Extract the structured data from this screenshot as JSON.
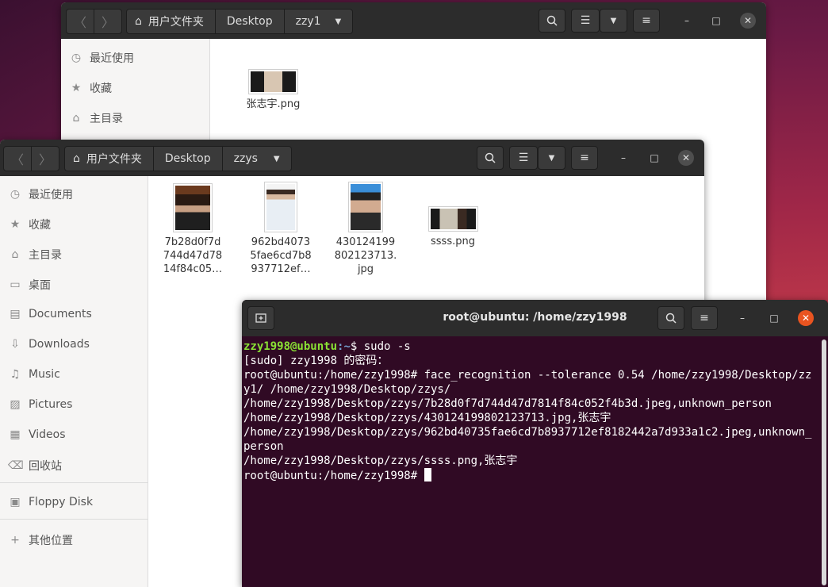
{
  "window1": {
    "path": [
      "用户文件夹",
      "Desktop",
      "zzy1"
    ],
    "sidebar": [
      {
        "icon": "clock-icon",
        "glyph": "◷",
        "label": "最近使用"
      },
      {
        "icon": "star-icon",
        "glyph": "★",
        "label": "收藏"
      },
      {
        "icon": "home-icon",
        "glyph": "⌂",
        "label": "主目录"
      }
    ],
    "files": [
      {
        "name": "张志宇.png"
      }
    ]
  },
  "window2": {
    "path": [
      "用户文件夹",
      "Desktop",
      "zzys"
    ],
    "sidebar": [
      {
        "icon": "clock-icon",
        "glyph": "◷",
        "label": "最近使用"
      },
      {
        "icon": "star-icon",
        "glyph": "★",
        "label": "收藏"
      },
      {
        "icon": "home-icon",
        "glyph": "⌂",
        "label": "主目录"
      },
      {
        "icon": "desktop-icon",
        "glyph": "▭",
        "label": "桌面"
      },
      {
        "icon": "document-icon",
        "glyph": "▤",
        "label": "Documents"
      },
      {
        "icon": "download-icon",
        "glyph": "⇩",
        "label": "Downloads"
      },
      {
        "icon": "music-icon",
        "glyph": "♫",
        "label": "Music"
      },
      {
        "icon": "pictures-icon",
        "glyph": "▨",
        "label": "Pictures"
      },
      {
        "icon": "videos-icon",
        "glyph": "▦",
        "label": "Videos"
      },
      {
        "icon": "trash-icon",
        "glyph": "🗑",
        "label": "回收站"
      },
      {
        "icon": "floppy-icon",
        "glyph": "▣",
        "label": "Floppy Disk"
      },
      {
        "icon": "plus-icon",
        "glyph": "+",
        "label": "其他位置"
      }
    ],
    "files": [
      {
        "line1": "7b28d0f7d",
        "line2": "744d47d78",
        "line3": "14f84c05…"
      },
      {
        "line1": "962bd4073",
        "line2": "5fae6cd7b8",
        "line3": "937712ef…"
      },
      {
        "line1": "430124199",
        "line2": "802123713.",
        "line3": "jpg"
      },
      {
        "line1": "ssss.png",
        "line2": "",
        "line3": ""
      }
    ]
  },
  "terminal": {
    "title": "root@ubuntu: /home/zzy1998",
    "prompt_user": "zzy1998@ubuntu",
    "prompt_path": ":~",
    "command1": "$ sudo -s",
    "lines": [
      "[sudo] zzy1998 的密码：",
      "root@ubuntu:/home/zzy1998# face_recognition --tolerance 0.54 /home/zzy1998/Desktop/zzy1/ /home/zzy1998/Desktop/zzys/",
      "/home/zzy1998/Desktop/zzys/7b28d0f7d744d47d7814f84c052f4b3d.jpeg,unknown_person",
      "/home/zzy1998/Desktop/zzys/430124199802123713.jpg,张志宇",
      "/home/zzy1998/Desktop/zzys/962bd40735fae6cd7b8937712ef8182442a7d933a1c2.jpeg,unknown_person",
      "/home/zzy1998/Desktop/zzys/ssss.png,张志宇"
    ],
    "final_prompt": "root@ubuntu:/home/zzy1998# "
  }
}
